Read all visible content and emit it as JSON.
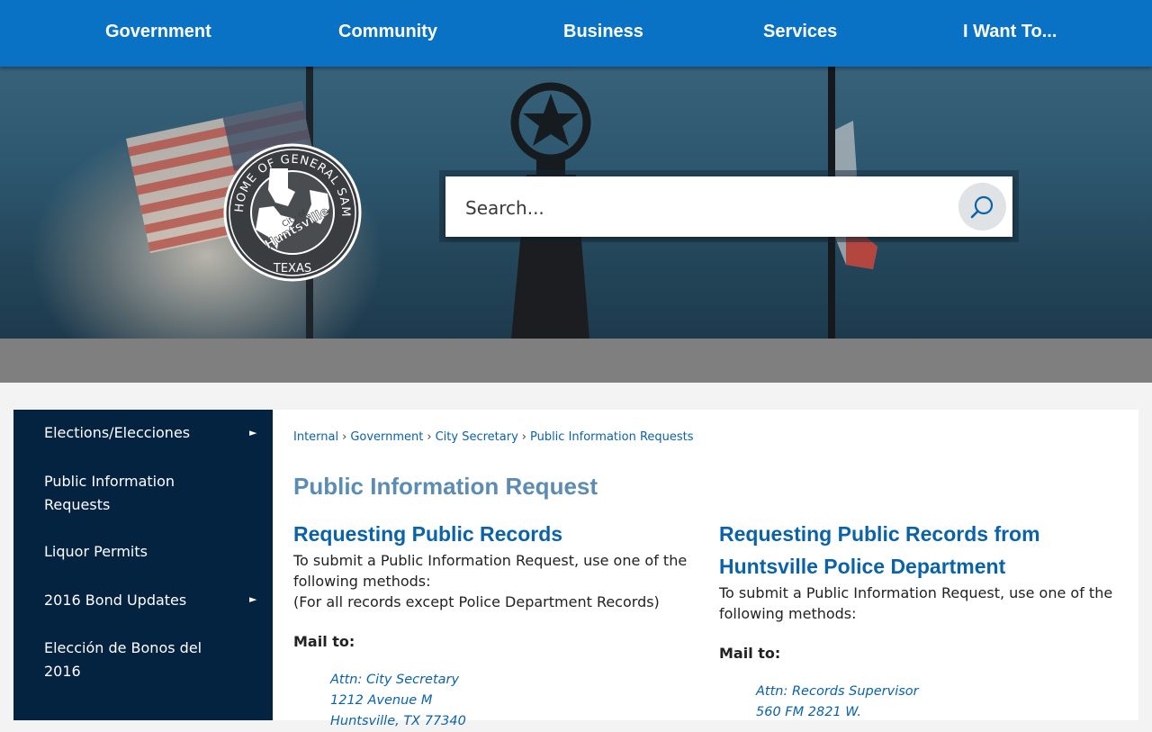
{
  "nav": {
    "items": [
      "Government",
      "Community",
      "Business",
      "Services",
      "I Want To..."
    ]
  },
  "search": {
    "placeholder": "Search..."
  },
  "seal": {
    "text_ring": "HOME OF GENERAL SAM HOUSTON",
    "state": "TEXAS",
    "city_of": "City of",
    "city": "Huntsville"
  },
  "sidebar": {
    "items": [
      {
        "label": "Elections/Elecciones",
        "has_submenu": true
      },
      {
        "label": "Public Information Requests",
        "has_submenu": false
      },
      {
        "label": "Liquor Permits",
        "has_submenu": false
      },
      {
        "label": "2016 Bond Updates",
        "has_submenu": true
      },
      {
        "label": "Elección de Bonos del 2016",
        "has_submenu": false
      }
    ],
    "arrow_glyph": "►"
  },
  "breadcrumb": [
    "Internal",
    "Government",
    "City Secretary",
    "Public Information Requests"
  ],
  "breadcrumb_sep": "›",
  "page_title": "Public Information Request",
  "left_col": {
    "heading": "Requesting Public Records",
    "intro": "To submit a Public Information Request, use one of the following methods:",
    "note": "(For all records except Police Department Records)",
    "mail_label": "Mail to:",
    "address": [
      "Attn: City Secretary",
      "1212 Avenue M",
      "Huntsville, TX 77340"
    ]
  },
  "right_col": {
    "heading": "Requesting Public Records from Huntsville Police Department",
    "intro": "To submit a Public Information Request, use one of the following methods:",
    "mail_label": "Mail to:",
    "address": [
      "Attn: Records Supervisor",
      "560 FM 2821 W."
    ]
  },
  "colors": {
    "nav_bg": "#0a72c4",
    "sidebar_bg": "#032341",
    "link": "#0a63a8",
    "title": "#5b8cb3"
  }
}
